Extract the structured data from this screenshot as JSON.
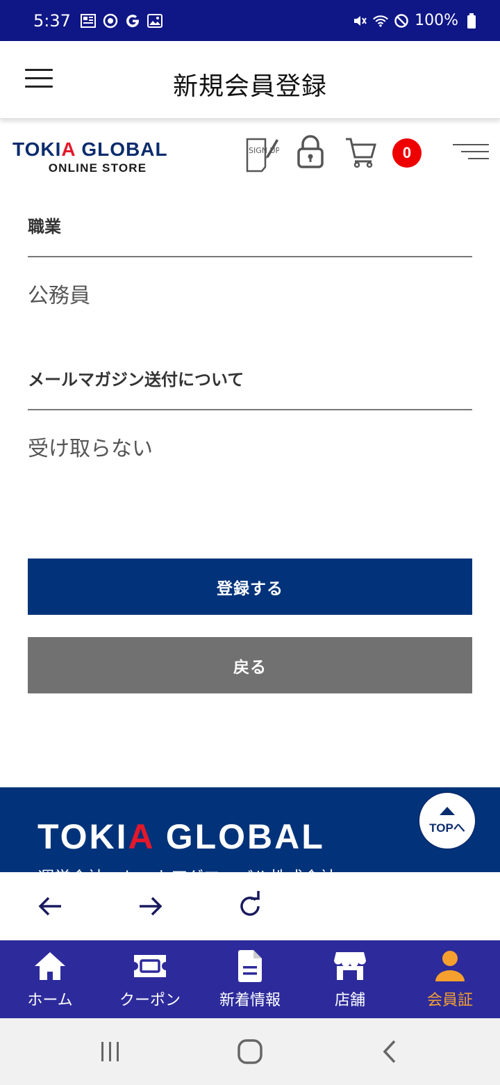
{
  "status_bar": {
    "time": "5:37",
    "battery": "100%",
    "icons": [
      "news-icon",
      "target-icon",
      "google-icon",
      "image-icon",
      "mute-icon",
      "wifi-icon",
      "block-icon",
      "battery-icon"
    ]
  },
  "header": {
    "title": "新規会員登録"
  },
  "store": {
    "logo_main_a": "TOKI",
    "logo_main_b": "A",
    "logo_main_c": " GLOBAL",
    "logo_sub": "ONLINE STORE",
    "signup_icon_text": "SIGN UP",
    "cart_count": "0"
  },
  "form": {
    "fields": [
      {
        "label": "職業",
        "value": "公務員"
      },
      {
        "label": "メールマガジン送付について",
        "value": "受け取らない"
      }
    ],
    "submit_label": "登録する",
    "back_label": "戻る"
  },
  "footer": {
    "logo_a": "TOKI",
    "logo_b": "A",
    "logo_c": " GLOBAL",
    "company": "運営会社：トーキアグローバル株式会社",
    "top_label": "TOPへ"
  },
  "tabs": [
    {
      "label": "ホーム",
      "icon": "home-icon"
    },
    {
      "label": "クーポン",
      "icon": "ticket-icon"
    },
    {
      "label": "新着情報",
      "icon": "document-icon"
    },
    {
      "label": "店舗",
      "icon": "store-icon"
    },
    {
      "label": "会員証",
      "icon": "person-icon",
      "active": true
    }
  ],
  "colors": {
    "status_bar": "#0f1686",
    "brand_navy": "#02337a",
    "brand_red": "#e4182b",
    "tab_bar": "#2d2b9b",
    "tab_active": "#f5a02e",
    "back_button": "#717171",
    "badge": "#ee0000"
  }
}
